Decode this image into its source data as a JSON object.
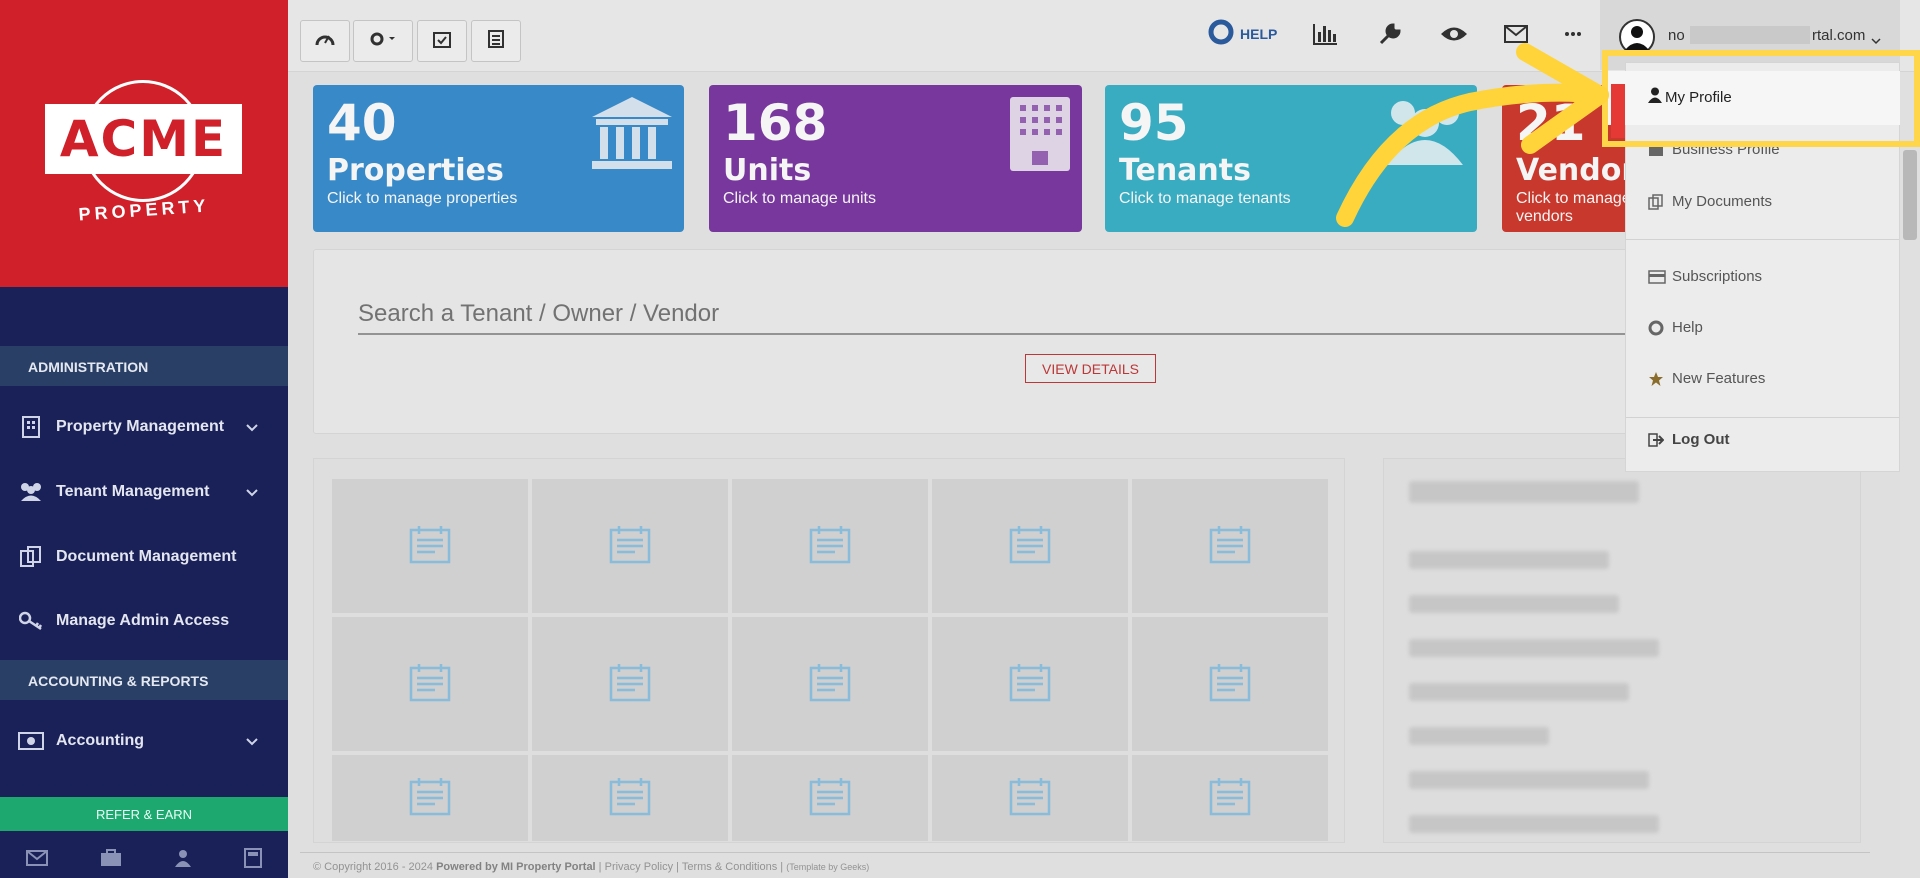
{
  "sidebar": {
    "logo_text": "ACME",
    "logo_sub": "PROPERTY",
    "section_admin": "ADMINISTRATION",
    "section_accounting": "ACCOUNTING & REPORTS",
    "items": [
      {
        "label": "Property Management",
        "icon": "building-icon"
      },
      {
        "label": "Tenant Management",
        "icon": "users-icon"
      },
      {
        "label": "Document Management",
        "icon": "documents-icon"
      },
      {
        "label": "Manage Admin Access",
        "icon": "key-icon"
      },
      {
        "label": "Accounting",
        "icon": "money-icon"
      }
    ],
    "refer_label": "REFER & EARN"
  },
  "topbar": {
    "help_label": "HELP",
    "user_prefix": "no",
    "user_suffix": "rtal.com"
  },
  "cards": [
    {
      "number": "40",
      "label": "Properties",
      "sub": "Click to manage properties",
      "color": "#3b8fd0"
    },
    {
      "number": "168",
      "label": "Units",
      "sub": "Click to manage units",
      "color": "#7d3aa4"
    },
    {
      "number": "95",
      "label": "Tenants",
      "sub": "Click to manage tenants",
      "color": "#3cb3c9"
    },
    {
      "number": "21",
      "label": "Vendors",
      "sub": "Click to manage vendors",
      "color": "#d23b2f"
    }
  ],
  "search": {
    "placeholder": "Search a Tenant / Owner / Vendor",
    "view_details": "VIEW DETAILS"
  },
  "dropdown": {
    "items": [
      {
        "label": "My Profile",
        "icon": "user-icon"
      },
      {
        "label": "Business Profile",
        "icon": "briefcase-icon"
      },
      {
        "label": "My Documents",
        "icon": "documents-icon"
      },
      {
        "label": "Subscriptions",
        "icon": "credit-card-icon"
      },
      {
        "label": "Help",
        "icon": "lifebuoy-icon"
      },
      {
        "label": "New Features",
        "icon": "star-icon"
      },
      {
        "label": "Log Out",
        "icon": "logout-icon"
      }
    ]
  },
  "footer": {
    "copyright": "© Copyright 2016 - 2024",
    "powered": "Powered by MI Property Portal",
    "privacy": "Privacy Policy",
    "terms": "Terms & Conditions",
    "template": "(Template by Geeks)"
  },
  "colors": {
    "sidebar_bg": "#1a2159",
    "logo_red": "#d0202a",
    "highlight_yellow": "#ffd54a",
    "arrow_yellow": "#ffd43b"
  }
}
